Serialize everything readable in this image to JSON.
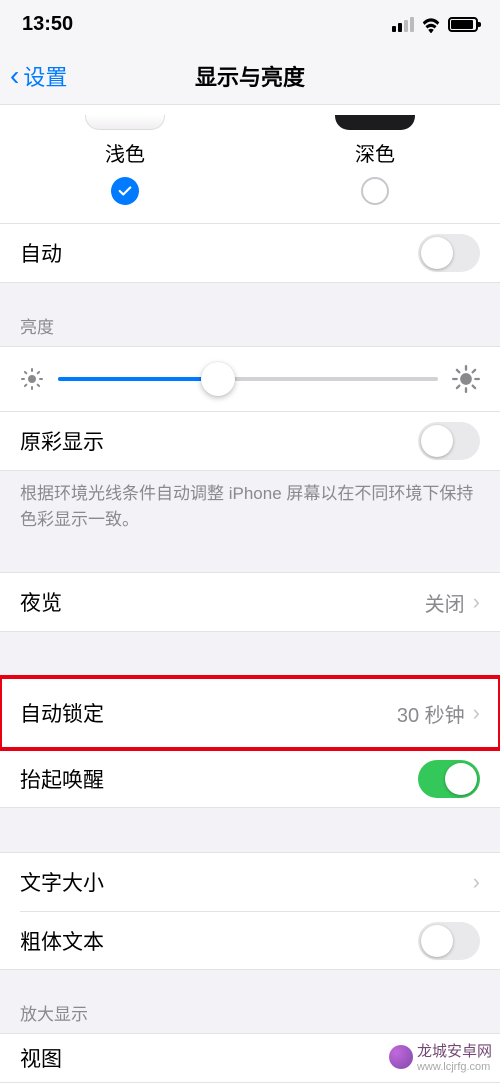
{
  "status": {
    "time": "13:50"
  },
  "nav": {
    "back": "设置",
    "title": "显示与亮度"
  },
  "appearance": {
    "light_label": "浅色",
    "dark_label": "深色",
    "selected": "light",
    "auto_label": "自动",
    "auto_on": false
  },
  "brightness": {
    "header": "亮度",
    "value_percent": 42,
    "true_tone_label": "原彩显示",
    "true_tone_on": false,
    "footer": "根据环境光线条件自动调整 iPhone 屏幕以在不同环境下保持色彩显示一致。"
  },
  "night_shift": {
    "label": "夜览",
    "value": "关闭"
  },
  "auto_lock": {
    "label": "自动锁定",
    "value": "30 秒钟"
  },
  "raise_to_wake": {
    "label": "抬起唤醒",
    "on": true
  },
  "text_size": {
    "label": "文字大小"
  },
  "bold_text": {
    "label": "粗体文本",
    "on": false
  },
  "zoom": {
    "header": "放大显示",
    "view_label": "视图"
  },
  "watermark": {
    "title": "龙城安卓网",
    "url": "www.lcjrfg.com"
  }
}
